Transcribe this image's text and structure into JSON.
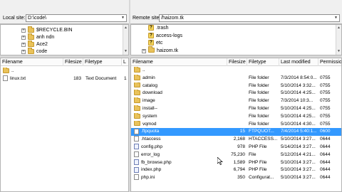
{
  "local_site": {
    "label": "Local site:",
    "path": "D:\\code\\",
    "tree": [
      {
        "name": "$RECYCLE.BIN",
        "expander": "+"
      },
      {
        "name": "anh ndn",
        "expander": "+"
      },
      {
        "name": "Ace2",
        "expander": "+"
      },
      {
        "name": "code",
        "expander": "+"
      }
    ],
    "columns": [
      "Filename",
      "Filesize",
      "Filetype",
      "L"
    ],
    "files": [
      {
        "name": "..",
        "size": "",
        "type": ""
      },
      {
        "name": "linux.txt",
        "size": "183",
        "type": "Text Document",
        "l": "1"
      }
    ]
  },
  "remote_site": {
    "label": "Remote site:",
    "path": "/haizom.tk",
    "tree": [
      {
        "name": ".trash",
        "icon": "question"
      },
      {
        "name": "access-logs",
        "icon": "question"
      },
      {
        "name": "etc",
        "icon": "question"
      },
      {
        "name": "haizom.tk",
        "icon": "folder",
        "expander": "+"
      }
    ],
    "columns": [
      "Filename",
      "Filesize",
      "Filetype",
      "Last modified",
      "Permissio"
    ],
    "files": [
      {
        "name": "..",
        "size": "",
        "type": "",
        "modified": "",
        "perm": "",
        "icon": "folder"
      },
      {
        "name": "admin",
        "size": "",
        "type": "File folder",
        "modified": "7/3/2014 8:54:0...",
        "perm": "0755",
        "icon": "folder"
      },
      {
        "name": "catalog",
        "size": "",
        "type": "File folder",
        "modified": "5/10/2014 3:32...",
        "perm": "0755",
        "icon": "folder"
      },
      {
        "name": "download",
        "size": "",
        "type": "File folder",
        "modified": "5/10/2014 4:25...",
        "perm": "0755",
        "icon": "folder"
      },
      {
        "name": "image",
        "size": "",
        "type": "File folder",
        "modified": "7/3/2014 10:3...",
        "perm": "0755",
        "icon": "folder"
      },
      {
        "name": "install--",
        "size": "",
        "type": "File folder",
        "modified": "5/10/2014 4:25...",
        "perm": "0755",
        "icon": "folder"
      },
      {
        "name": "system",
        "size": "",
        "type": "File folder",
        "modified": "5/10/2014 4:25...",
        "perm": "0755",
        "icon": "folder"
      },
      {
        "name": "vqmod",
        "size": "",
        "type": "File folder",
        "modified": "5/10/2014 4:30...",
        "perm": "0755",
        "icon": "folder"
      },
      {
        "name": ".ftpquota",
        "size": "15",
        "type": "FTPQUOT...",
        "modified": "7/4/2014 5:40:1...",
        "perm": "0600",
        "icon": "file",
        "selected": true
      },
      {
        "name": ".htaccess",
        "size": "2,168",
        "type": "HTACCESS...",
        "modified": "5/10/2014 3:27...",
        "perm": "0644",
        "icon": "file"
      },
      {
        "name": "config.php",
        "size": "978",
        "type": "PHP File",
        "modified": "5/14/2014 3:27...",
        "perm": "0644",
        "icon": "php"
      },
      {
        "name": "error_log",
        "size": "75,230",
        "type": "File",
        "modified": "5/12/2014 4:21...",
        "perm": "0644",
        "icon": "file"
      },
      {
        "name": "fb_browse.php",
        "size": "1,589",
        "type": "PHP File",
        "modified": "5/10/2014 3:27...",
        "perm": "0644",
        "icon": "php"
      },
      {
        "name": "index.php",
        "size": "6,794",
        "type": "PHP File",
        "modified": "5/10/2014 3:27...",
        "perm": "0644",
        "icon": "php"
      },
      {
        "name": "php.ini",
        "size": "350",
        "type": "Configurat...",
        "modified": "5/10/2014 3:27...",
        "perm": "0644",
        "icon": "file"
      }
    ]
  },
  "icons": {
    "folder": "folder-icon",
    "question": "unknown-folder-icon",
    "file": "file-icon",
    "php": "php-file-icon",
    "cursor": "cursor-icon"
  },
  "colors": {
    "selection": "#3399ff",
    "folder": "#e9c25a"
  }
}
